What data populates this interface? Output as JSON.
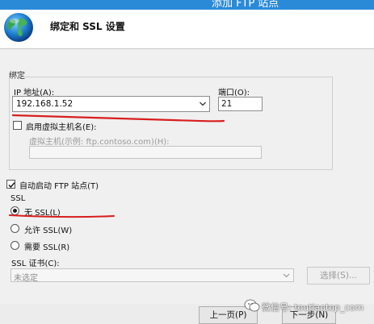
{
  "window": {
    "title": "添加 FTP 站点"
  },
  "header": {
    "heading": "绑定和 SSL 设置",
    "icon": "globe-icon"
  },
  "binding": {
    "group_label": "绑定",
    "ip_label": "IP 地址(A):",
    "ip_value": "192.168.1.52",
    "port_label": "端口(O):",
    "port_value": "21",
    "virtual_host_checkbox_label": "启用虚拟主机名(E):",
    "virtual_host_checked": false,
    "virtual_host_field_label": "虚拟主机(示例: ftp.contoso.com)(H):",
    "virtual_host_value": ""
  },
  "auto_start": {
    "label": "自动启动 FTP 站点(T)",
    "checked": true
  },
  "ssl": {
    "section_label": "SSL",
    "options": [
      {
        "label": "无 SSL(L)",
        "selected": true
      },
      {
        "label": "允许 SSL(W)",
        "selected": false
      },
      {
        "label": "需要 SSL(R)",
        "selected": false
      }
    ],
    "cert_label": "SSL 证书(C):",
    "cert_value": "未选定",
    "select_button": "选择(S)..."
  },
  "footer": {
    "prev_button": "上一页(P)",
    "next_button": "下一步(N)"
  },
  "watermark": {
    "text": "微信号: toutiaotop_com"
  },
  "colors": {
    "annotation": "#d81e1e",
    "titlebar": "#2b8ad8"
  }
}
